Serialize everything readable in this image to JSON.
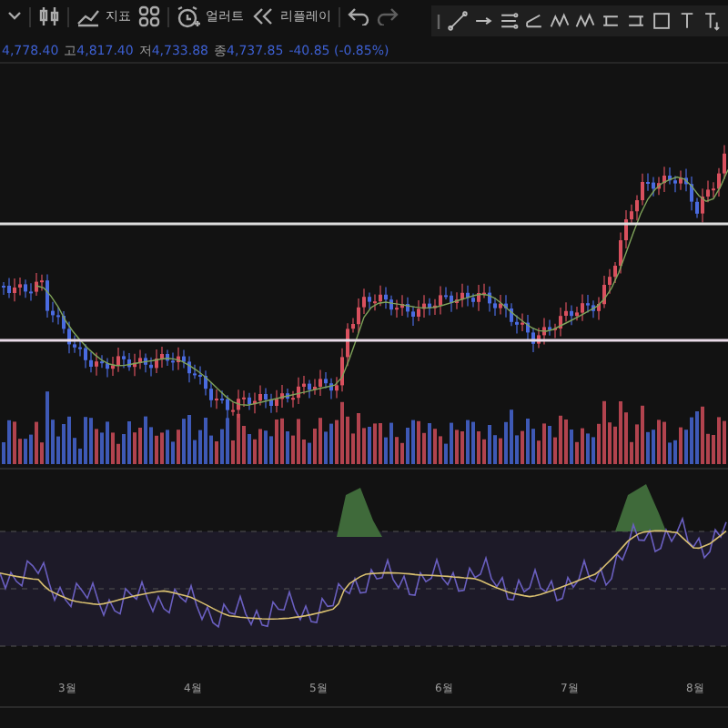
{
  "toolbar": {
    "items": [
      {
        "kind": "caret"
      },
      {
        "kind": "candles"
      },
      {
        "kind": "indicators",
        "label": "지표"
      },
      {
        "kind": "grid"
      },
      {
        "kind": "alert",
        "label": "얼러트"
      },
      {
        "kind": "replay",
        "label": "리플레이"
      },
      {
        "kind": "undo"
      },
      {
        "kind": "redo"
      }
    ]
  },
  "quote": {
    "fields": [
      {
        "value": "4,778.40"
      },
      {
        "label": "고",
        "value": "4,817.40"
      },
      {
        "label": "저",
        "value": "4,733.88"
      },
      {
        "label": "종",
        "value": "4,737.85"
      }
    ],
    "change": "-40.85 (-0.85%)"
  },
  "time_axis": [
    "3월",
    "4월",
    "5월",
    "6월",
    "7월",
    "8월"
  ]
}
